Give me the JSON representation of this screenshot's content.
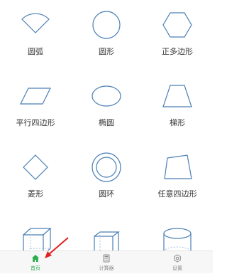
{
  "colors": {
    "shape_stroke": "#4a7fb5",
    "active_tab": "#2cae4f",
    "inactive_tab": "#888888",
    "annotation_arrow": "#e02020"
  },
  "shapes": [
    {
      "label": "圆弧",
      "icon": "arc-sector-icon"
    },
    {
      "label": "圆形",
      "icon": "circle-icon"
    },
    {
      "label": "正多边形",
      "icon": "hexagon-icon"
    },
    {
      "label": "平行四边形",
      "icon": "parallelogram-icon"
    },
    {
      "label": "椭圆",
      "icon": "ellipse-icon"
    },
    {
      "label": "梯形",
      "icon": "trapezoid-icon"
    },
    {
      "label": "菱形",
      "icon": "rhombus-icon"
    },
    {
      "label": "圆环",
      "icon": "ring-icon"
    },
    {
      "label": "任意四边形",
      "icon": "quadrilateral-icon"
    },
    {
      "label": "",
      "icon": "cube-icon"
    },
    {
      "label": "",
      "icon": "cuboid-icon"
    },
    {
      "label": "",
      "icon": "cylinder-icon"
    }
  ],
  "tabbar": {
    "tabs": [
      {
        "label": "首页",
        "icon": "home-icon",
        "active": true
      },
      {
        "label": "计算器",
        "icon": "calculator-icon",
        "active": false
      },
      {
        "label": "设置",
        "icon": "settings-icon",
        "active": false
      }
    ]
  }
}
